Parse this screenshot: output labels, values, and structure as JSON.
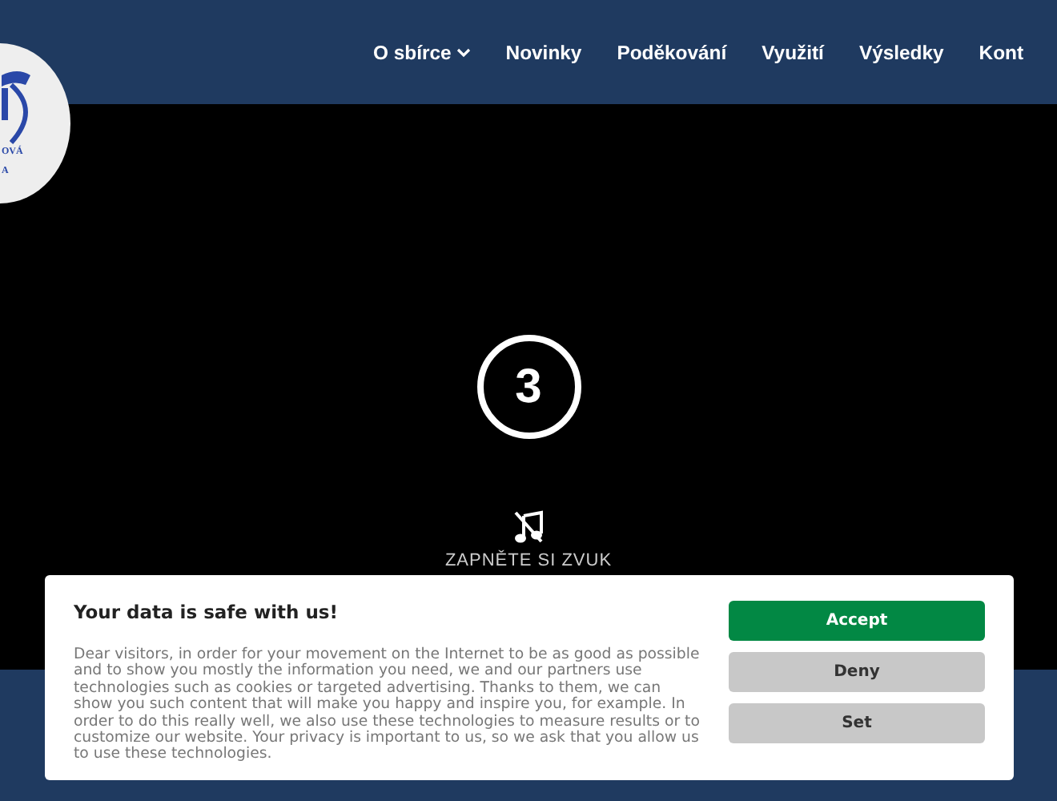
{
  "logo": {
    "text_lines": [
      "OVÁ",
      "A"
    ]
  },
  "nav": [
    {
      "label": "O sbírce",
      "kind": "dropdown"
    },
    {
      "label": "Novinky",
      "kind": "link"
    },
    {
      "label": "Poděkování",
      "kind": "link"
    },
    {
      "label": "Využití",
      "kind": "link"
    },
    {
      "label": "Výsledky",
      "kind": "link"
    },
    {
      "label": "Kont",
      "kind": "link"
    }
  ],
  "hero": {
    "countdown": "3",
    "sound_prompt": "ZAPNĚTE SI ZVUK"
  },
  "cookie_dialog": {
    "title": "Your data is safe with us!",
    "text": "Dear visitors, in order for your movement on the Internet to be as good as possible and to show you mostly the information you need, we and our partners use technologies such as cookies or targeted advertising. Thanks to them, we can show you such content that will make you happy and inspire you, for example. In order to do this really well, we also use these technologies to measure results or to customize our website. Your privacy is important to us, so we ask that you allow us to use these technologies.",
    "buttons": [
      {
        "label": "Accept",
        "kind": "primary"
      },
      {
        "label": "Deny",
        "kind": "secondary"
      },
      {
        "label": "Set",
        "kind": "secondary"
      }
    ]
  }
}
